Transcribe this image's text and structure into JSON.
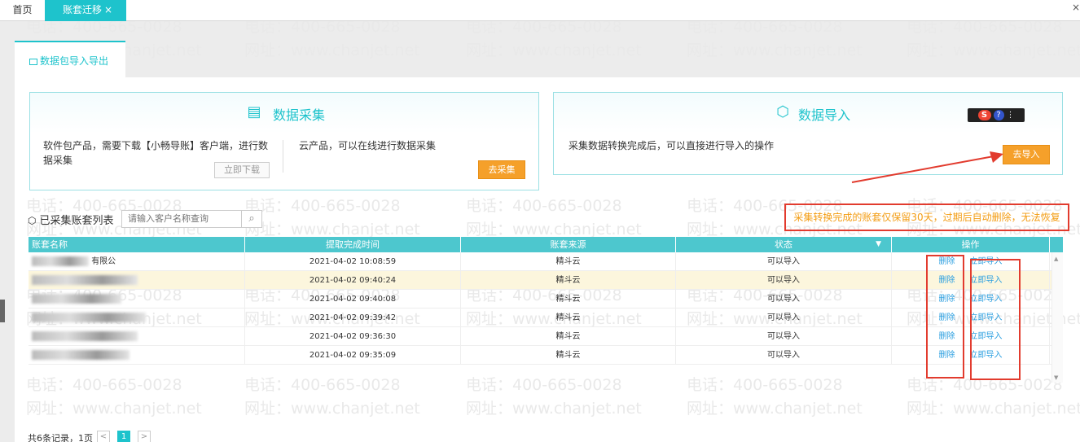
{
  "tabs": {
    "home": "首页",
    "active": "账套迁移",
    "close": "×"
  },
  "window_close": "×",
  "subtab": {
    "icon": "monitor-icon",
    "label": "数据包导入导出"
  },
  "collect_card": {
    "title": "数据采集",
    "software_desc": "软件包产品，需要下载【小畅导账】客户端，进行数据采集",
    "download_button": "立即下载",
    "cloud_desc": "云产品，可以在线进行数据采集",
    "collect_button": "去采集"
  },
  "import_card": {
    "title": "数据导入",
    "desc": "采集数据转换完成后，可以直接进行导入的操作",
    "import_button": "去导入",
    "widget_s": "S",
    "widget_q": "?",
    "widget_more": "⋮"
  },
  "list": {
    "title": "已采集账套列表",
    "search_placeholder": "请输入客户名称查询",
    "notice": "采集转换完成的账套仅保留30天，过期后自动删除，无法恢复"
  },
  "table": {
    "columns": [
      "账套名称",
      "提取完成时间",
      "账套来源",
      "状态",
      "操作"
    ],
    "rows": [
      {
        "name_tail": "有限公",
        "time": "2021-04-02 10:08:59",
        "source": "精斗云",
        "status": "可以导入"
      },
      {
        "name_tail": "",
        "time": "2021-04-02 09:40:24",
        "source": "精斗云",
        "status": "可以导入"
      },
      {
        "name_tail": "",
        "time": "2021-04-02 09:40:08",
        "source": "精斗云",
        "status": "可以导入"
      },
      {
        "name_tail": "",
        "time": "2021-04-02 09:39:42",
        "source": "精斗云",
        "status": "可以导入"
      },
      {
        "name_tail": "",
        "time": "2021-04-02 09:36:30",
        "source": "精斗云",
        "status": "可以导入"
      },
      {
        "name_tail": "",
        "time": "2021-04-02 09:35:09",
        "source": "精斗云",
        "status": "可以导入"
      }
    ],
    "delete_label": "删除",
    "import_label": "立即导入"
  },
  "pager": {
    "summary": "共6条记录，1页",
    "prev": "<",
    "current": "1",
    "next": ">"
  },
  "watermark": {
    "phone": "电话：400-665-0028",
    "site": "网址：www.chanjet.net"
  },
  "colors": {
    "accent": "#1ec3cc",
    "orange": "#f5a02a",
    "red": "#e23b2e",
    "link": "#2b9fe0",
    "notice_text": "#f39c12"
  }
}
